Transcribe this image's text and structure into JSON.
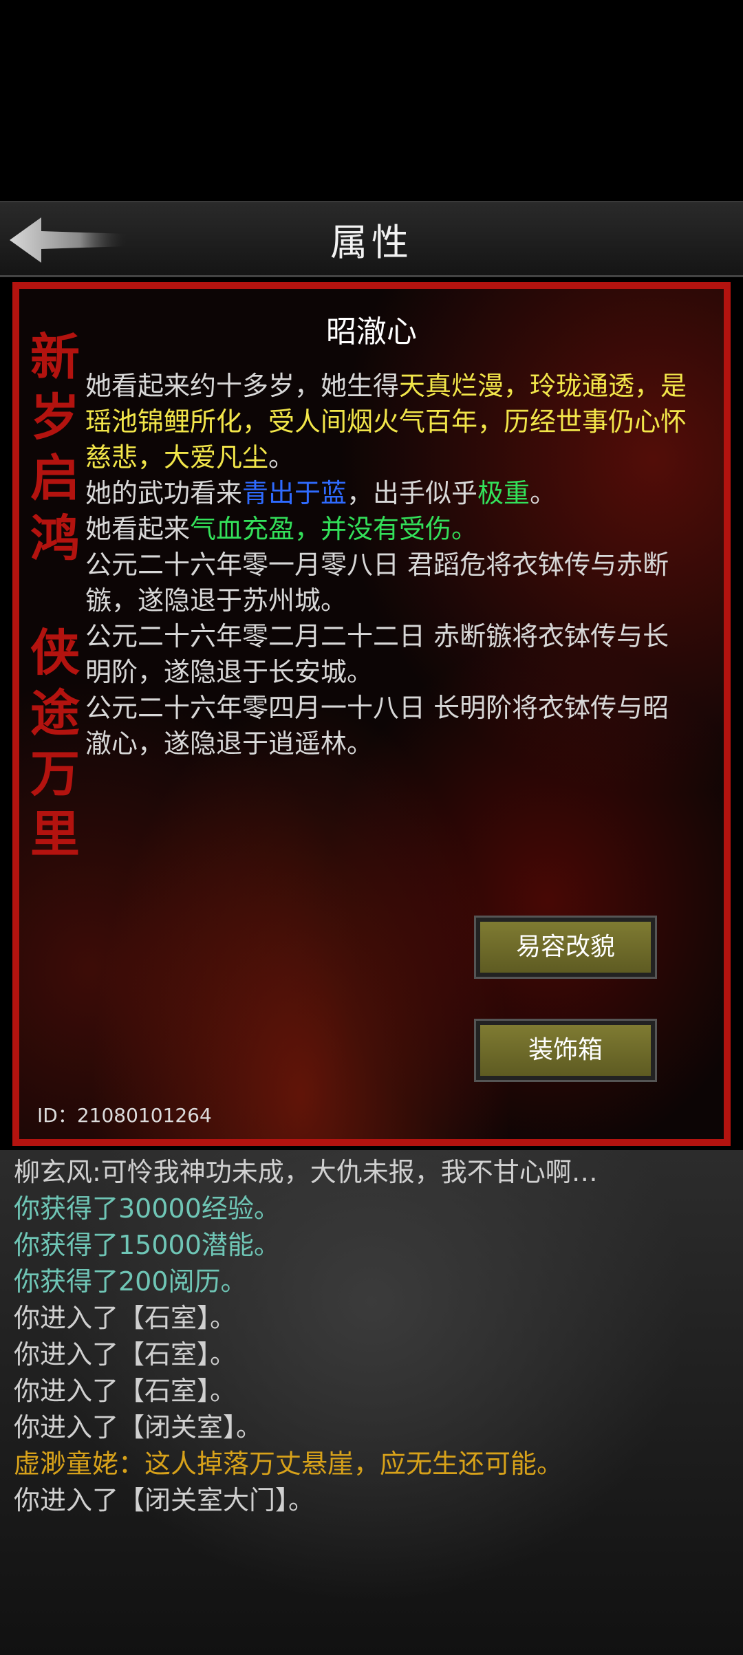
{
  "header": {
    "title": "属性",
    "back_icon": "back-arrow-icon"
  },
  "panel": {
    "calligraphy_top": "新岁启鸿",
    "calligraphy_bottom": "侠途万里",
    "name": "昭澈心",
    "desc": {
      "l1_a": "她看起来约十多岁，她生得",
      "l1_b": "天真烂漫，玲珑通透，是瑶池锦鲤所化，受人间烟火气百年，历经世事仍心怀慈悲，大爱凡尘",
      "l1_c": "。",
      "l2_a": "她的武功看来",
      "l2_b": "青出于蓝",
      "l2_c": "，出手似乎",
      "l2_d": "极重",
      "l2_e": "。",
      "l3_a": "她看起来",
      "l3_b": "气血充盈，并没有受伤。",
      "history": [
        "公元二十六年零一月零八日 君蹈危将衣钵传与赤断镞，遂隐退于苏州城。",
        "公元二十六年零二月二十二日 赤断镞将衣钵传与长明阶，遂隐退于长安城。",
        "公元二十六年零四月一十八日 长明阶将衣钵传与昭澈心，遂隐退于逍遥林。"
      ]
    },
    "buttons": {
      "disguise": "易容改貌",
      "decoration": "装饰箱"
    },
    "id_text": "ID：21080101264"
  },
  "log": [
    "柳玄风:可怜我神功未成，大仇未报，我不甘心啊…",
    "你获得了30000经验。",
    "你获得了15000潜能。",
    "你获得了200阅历。",
    "你进入了【石室】。",
    "你进入了【石室】。",
    "你进入了【石室】。",
    "你进入了【闭关室】。",
    "虚渺童姥：这人掉落万丈悬崖，应无生还可能。",
    "你进入了【闭关室大门】。"
  ],
  "colors": {
    "panel_border": "#b3130f",
    "highlight_yellow": "#f2e64a",
    "highlight_blue": "#2f6bff",
    "highlight_green": "#33e05a",
    "log_cyan": "#6fc6b6",
    "log_orange": "#d8a21a"
  }
}
